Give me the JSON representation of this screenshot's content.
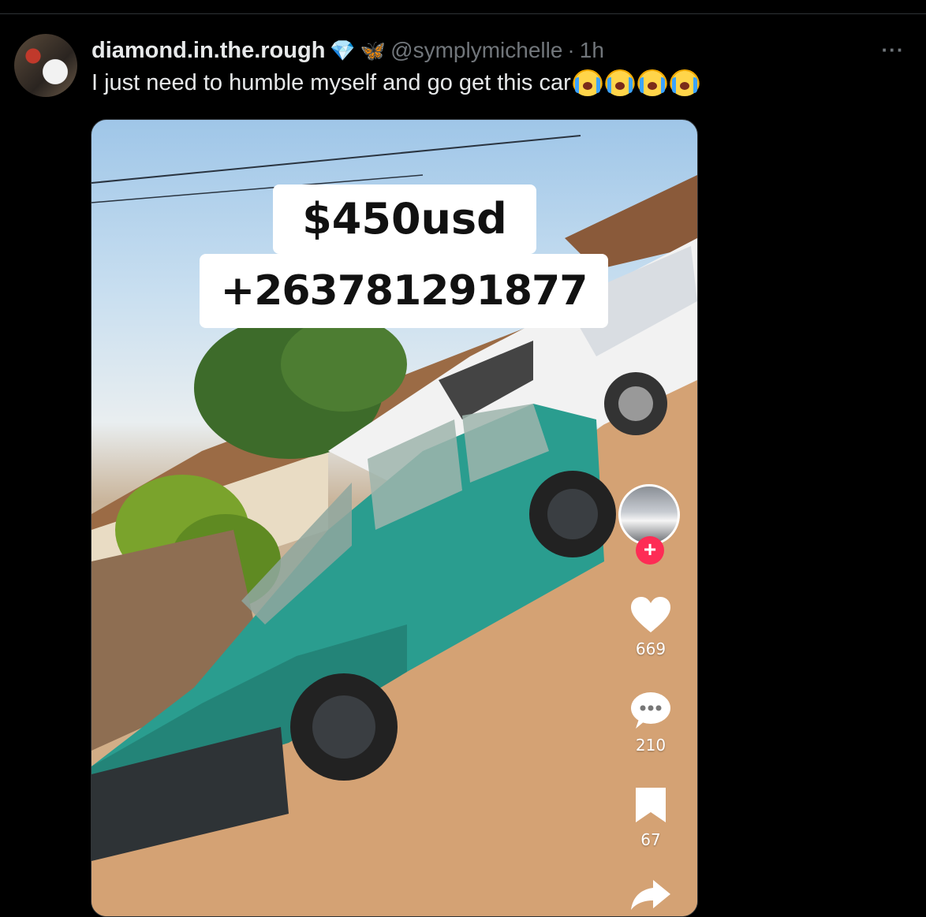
{
  "tweet": {
    "display_name": "diamond.in.the.rough",
    "name_emoji_1": "💎",
    "name_emoji_2": "🦋",
    "handle": "@symplymichelle",
    "separator": "·",
    "time": "1h",
    "more_label": "···",
    "text": "I just need to humble myself and go get this car",
    "text_emojis": [
      "loudly-crying-face",
      "loudly-crying-face",
      "loudly-crying-face",
      "loudly-crying-face"
    ]
  },
  "media": {
    "overlay_price": "$450usd",
    "overlay_phone": "+263781291877",
    "follow_plus": "+",
    "likes": "669",
    "comments": "210",
    "bookmarks": "67",
    "car_color": "#2a9d8f"
  }
}
